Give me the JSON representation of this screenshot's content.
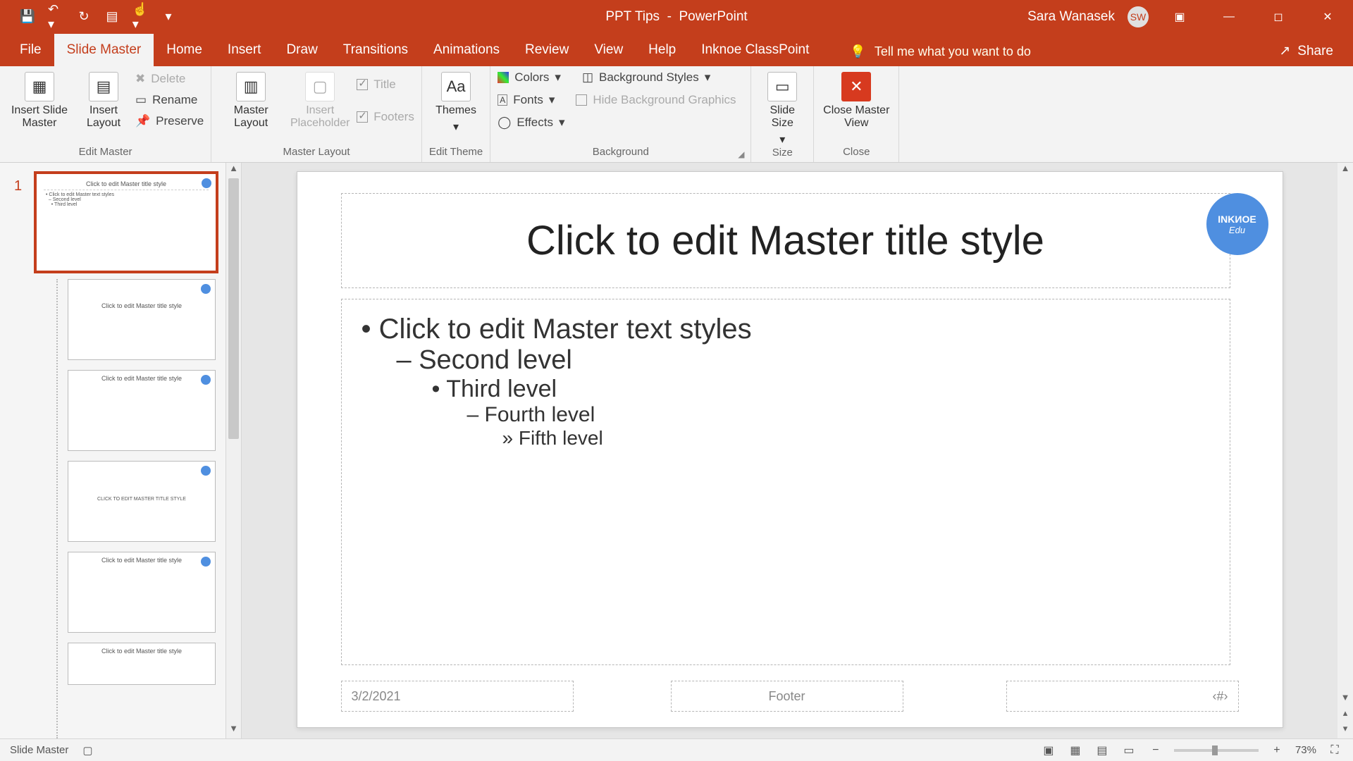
{
  "titlebar": {
    "doc_name": "PPT Tips",
    "app_name": "PowerPoint",
    "user_name": "Sara Wanasek",
    "user_initials": "SW"
  },
  "tabs": {
    "file": "File",
    "slide_master": "Slide Master",
    "home": "Home",
    "insert": "Insert",
    "draw": "Draw",
    "transitions": "Transitions",
    "animations": "Animations",
    "review": "Review",
    "view": "View",
    "help": "Help",
    "addin": "Inknoe ClassPoint",
    "tellme": "Tell me what you want to do",
    "share": "Share"
  },
  "ribbon": {
    "insert_slide_master": "Insert Slide Master",
    "insert_layout": "Insert Layout",
    "delete": "Delete",
    "rename": "Rename",
    "preserve": "Preserve",
    "edit_master_group": "Edit Master",
    "master_layout": "Master Layout",
    "insert_placeholder": "Insert Placeholder",
    "title_chk": "Title",
    "footers_chk": "Footers",
    "master_layout_group": "Master Layout",
    "themes": "Themes",
    "edit_theme_group": "Edit Theme",
    "colors": "Colors",
    "fonts": "Fonts",
    "effects": "Effects",
    "background_styles": "Background Styles",
    "hide_bg": "Hide Background Graphics",
    "background_group": "Background",
    "slide_size": "Slide Size",
    "size_group": "Size",
    "close_master": "Close Master View",
    "close_group": "Close"
  },
  "slide_content": {
    "master_title": "Click to edit Master title style",
    "lvl1": "Click to edit Master text styles",
    "lvl2": "Second level",
    "lvl3": "Third level",
    "lvl4": "Fourth level",
    "lvl5": "Fifth level",
    "date": "3/2/2021",
    "footer": "Footer",
    "slide_num": "‹#›"
  },
  "badge": {
    "line1": "INKИOE",
    "line2": "Edu"
  },
  "thumbs": {
    "master_num": "1",
    "title_text": "Click to edit Master title style",
    "section_text": "CLICK TO EDIT MASTER TITLE STYLE"
  },
  "status": {
    "mode": "Slide Master",
    "zoom": "73%"
  }
}
